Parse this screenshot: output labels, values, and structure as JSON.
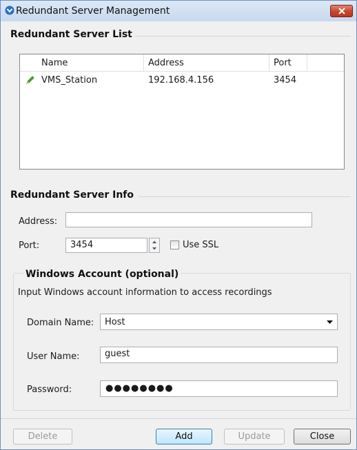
{
  "window": {
    "title": "Redundant Server Management",
    "icon": "app-chevron-icon"
  },
  "list_section": {
    "title": "Redundant Server List",
    "columns": [
      "Name",
      "Address",
      "Port"
    ],
    "rows": [
      {
        "icon": "pencil-icon",
        "name": "VMS_Station",
        "address": "192.168.4.156",
        "port": "3454"
      }
    ]
  },
  "info_section": {
    "title": "Redundant Server Info",
    "address_label": "Address:",
    "address_value": "",
    "port_label": "Port:",
    "port_value": "3454",
    "use_ssl_label": "Use SSL",
    "use_ssl_checked": false
  },
  "windows_account": {
    "title": "Windows Account (optional)",
    "description": "Input Windows account information to access recordings",
    "domain_label": "Domain Name:",
    "domain_value": "Host",
    "user_label": "User Name:",
    "user_value": "guest",
    "password_label": "Password:",
    "password_mask": "●●●●●●●●"
  },
  "buttons": {
    "delete": "Delete",
    "add": "Add",
    "update": "Update",
    "close": "Close"
  },
  "colors": {
    "titlebar": "#c8d9ee",
    "close_button": "#c7452c",
    "default_button_border": "#3c7fb1"
  }
}
